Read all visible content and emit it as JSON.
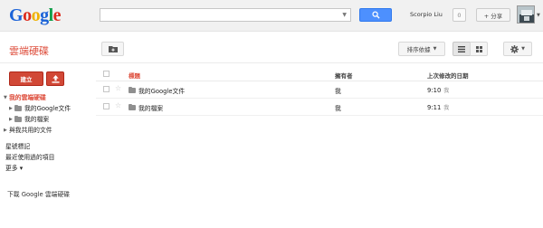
{
  "header": {
    "logo": [
      "G",
      "o",
      "o",
      "g",
      "l",
      "e"
    ],
    "logo_colors": [
      "#1a62d8",
      "#dd2b1d",
      "#f0b100",
      "#1a62d8",
      "#11a04b",
      "#dd2b1d"
    ],
    "search_value": "",
    "user_name": "Scorpio Liu",
    "notification_count": "0",
    "share_label": "+ 分享"
  },
  "toolbar": {
    "app_title": "雲端硬碟",
    "sort_label": "排序依據"
  },
  "sidebar": {
    "create_label": "建立",
    "items": [
      {
        "label": "我的雲端硬碟",
        "expanded": true
      },
      {
        "label": "我的Google文件"
      },
      {
        "label": "我的檔案"
      },
      {
        "label": "與我共用的文件"
      },
      {
        "label": "星號標記"
      },
      {
        "label": "最近使用過的項目"
      },
      {
        "label": "更多 ▾"
      }
    ],
    "download_label": "下載 Google 雲端硬碟"
  },
  "list": {
    "headers": {
      "title": "標題",
      "owner": "擁有者",
      "modified": "上次修改的日期"
    },
    "rows": [
      {
        "title": "我的Google文件",
        "owner": "我",
        "modified": "9:10",
        "modified_by": "我"
      },
      {
        "title": "我的檔案",
        "owner": "我",
        "modified": "9:11",
        "modified_by": "我"
      }
    ]
  },
  "colors": {
    "accent_red": "#dd4b39",
    "button_red": "#d14836",
    "search_blue": "#4d90fe"
  }
}
